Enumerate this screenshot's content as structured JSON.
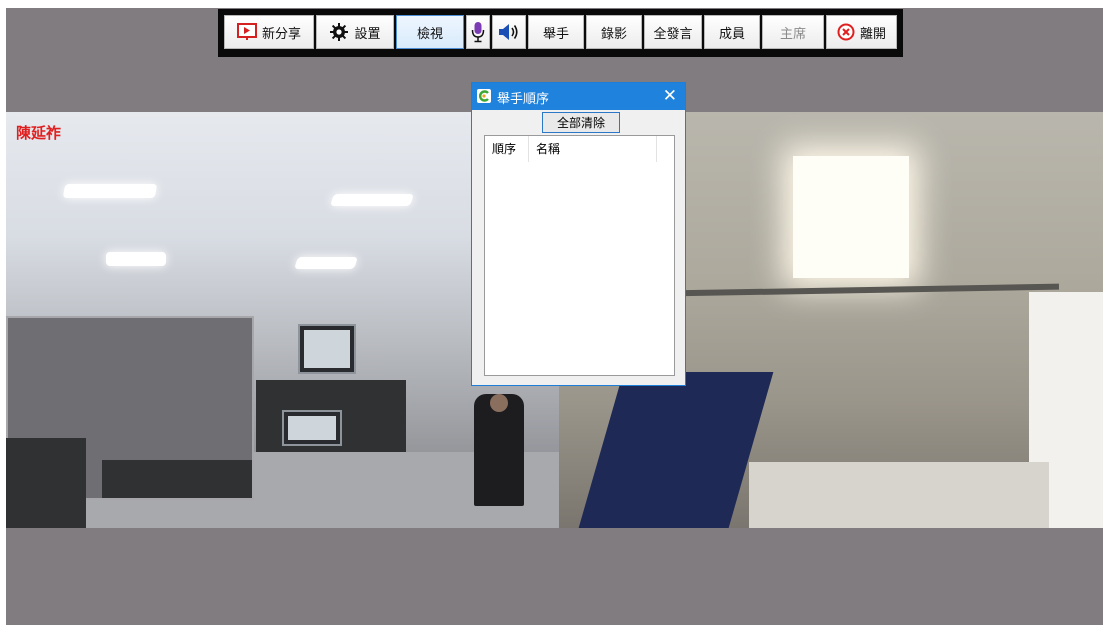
{
  "toolbar": {
    "buttons": [
      {
        "label": "新分享",
        "icon": "presentation-share-icon"
      },
      {
        "label": "設置",
        "icon": "gear-icon"
      },
      {
        "label": "檢視",
        "icon": ""
      },
      {
        "label": "",
        "icon": "microphone-icon"
      },
      {
        "label": "",
        "icon": "speaker-icon"
      },
      {
        "label": "舉手",
        "icon": ""
      },
      {
        "label": "錄影",
        "icon": ""
      },
      {
        "label": "全發言",
        "icon": ""
      },
      {
        "label": "成員",
        "icon": ""
      },
      {
        "label": "主席",
        "icon": "",
        "disabled": true
      },
      {
        "label": "離開",
        "icon": "leave-circle-x-icon"
      }
    ]
  },
  "video": {
    "participant_name": "陳延祚"
  },
  "dialog": {
    "title": "舉手順序",
    "close_symbol": "✕",
    "clear_all_label": "全部清除",
    "list": {
      "columns": [
        "順序",
        "名稱"
      ],
      "rows": []
    }
  },
  "colors": {
    "background": "#807c80",
    "toolbar": "#0a0a0a",
    "dialog_titlebar": "#1f82dc",
    "name_text": "#e02020",
    "leave_icon": "#e02020"
  }
}
